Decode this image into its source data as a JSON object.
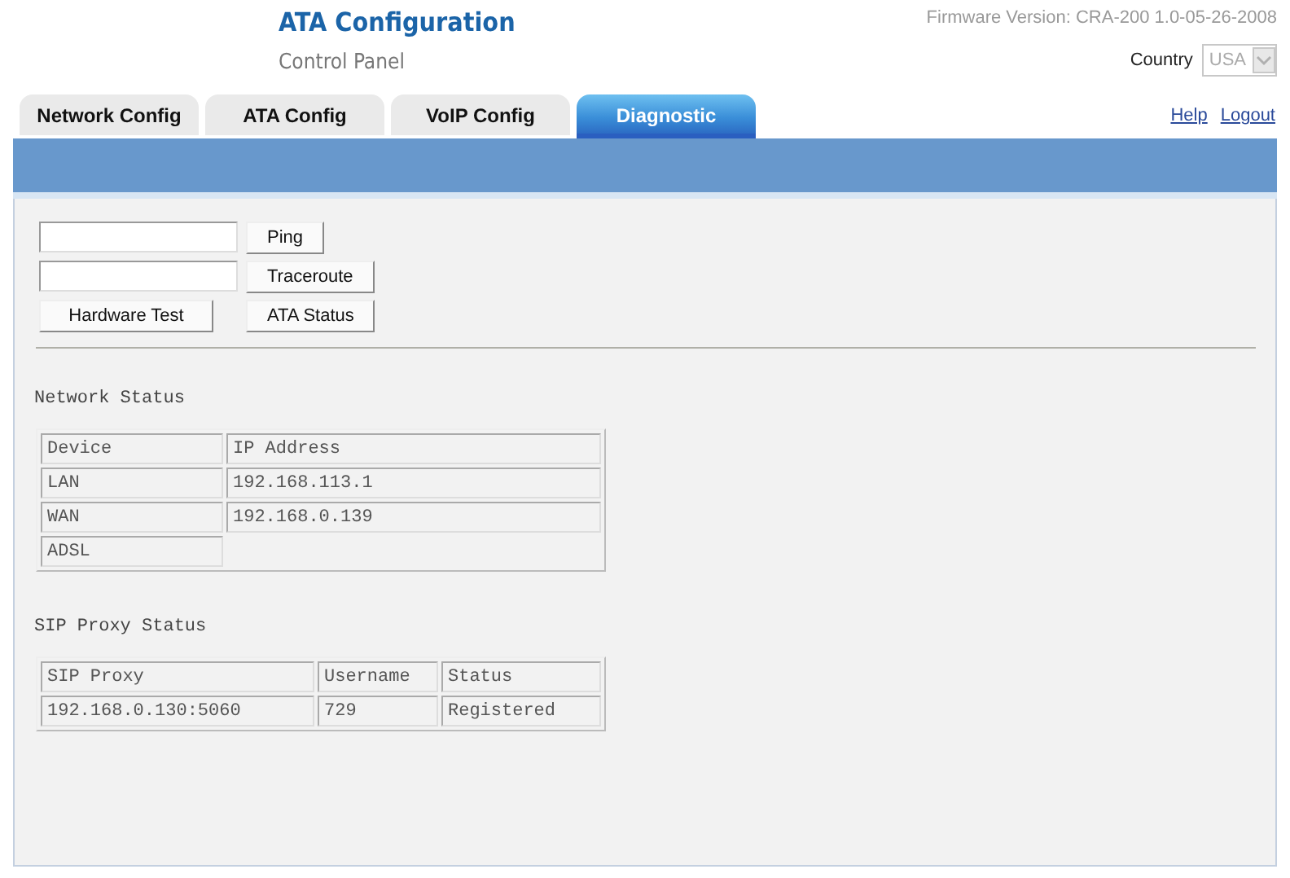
{
  "header": {
    "title": "ATA Configuration",
    "subtitle": "Control Panel",
    "firmware": "Firmware Version: CRA-200 1.0-05-26-2008",
    "country": {
      "label": "Country",
      "value": "USA"
    }
  },
  "tabs": [
    {
      "label": "Network Config",
      "selected": false
    },
    {
      "label": "ATA Config",
      "selected": false
    },
    {
      "label": "VoIP Config",
      "selected": false
    },
    {
      "label": "Diagnostic",
      "selected": true
    }
  ],
  "links": [
    "Help",
    "Logout"
  ],
  "tools": [
    {
      "kind": "field",
      "button": "Ping"
    },
    {
      "kind": "field",
      "button": "Traceroute"
    },
    {
      "kind": "pair",
      "buttons": [
        "Hardware Test",
        "ATA Status"
      ]
    }
  ],
  "network_status": {
    "title": "Network Status",
    "columns": [
      "Device",
      "IP Address"
    ],
    "rows": [
      [
        "LAN",
        "192.168.113.1"
      ],
      [
        "WAN",
        "192.168.0.139"
      ],
      [
        "ADSL",
        ""
      ]
    ]
  },
  "sip_status": {
    "title": "SIP Proxy Status",
    "columns": [
      "SIP Proxy",
      "Username",
      "Status"
    ],
    "rows": [
      [
        "192.168.0.130:5060",
        "729",
        "Registered"
      ]
    ]
  }
}
